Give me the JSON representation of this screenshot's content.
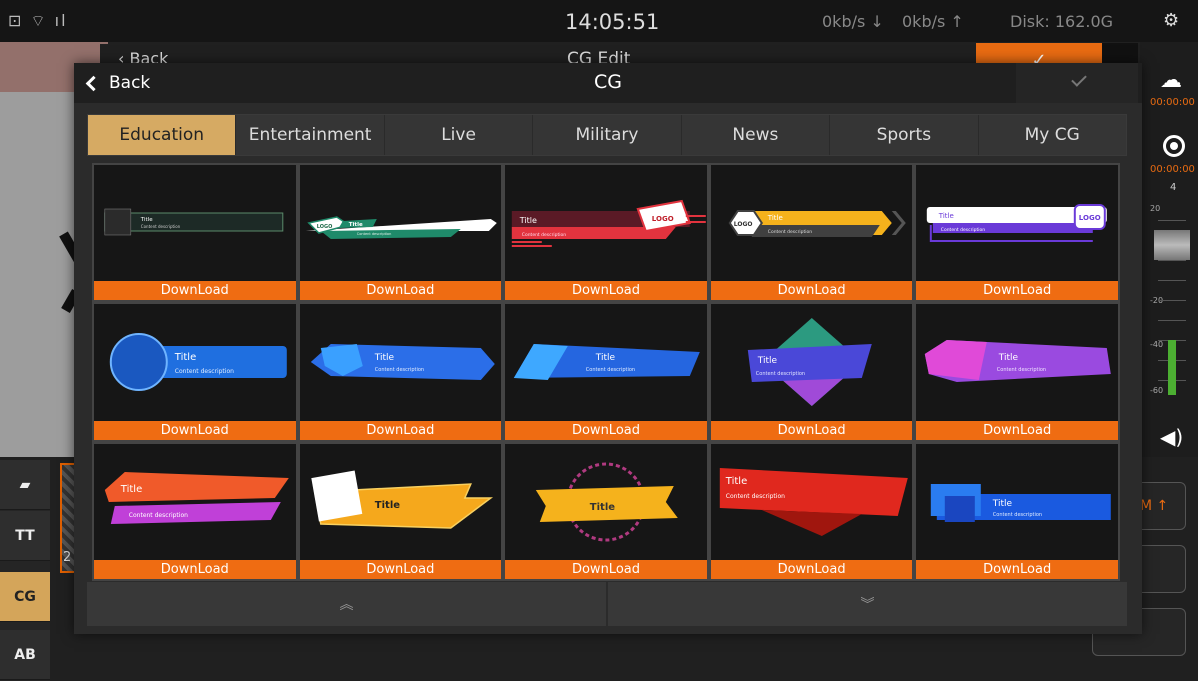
{
  "status": {
    "icons": "⊡ ⌔ ıl",
    "time": "14:05:51",
    "down_rate": "0kb/s ↓",
    "up_rate": "0kb/s ↑",
    "disk": "Disk: 162.0G",
    "settings_icon": "⚙"
  },
  "background": {
    "back_label": "Back",
    "title": "CG Edit",
    "ok_icon": "✓",
    "tools": [
      "▰",
      "TT",
      "CG",
      "AB"
    ],
    "thumb_number": "2",
    "right_time1": "00:00:00",
    "right_time2": "00:00:00",
    "right_count": "4",
    "meter_labels": [
      "20",
      "-20",
      "-40",
      "-60"
    ],
    "rbtn1": "M ↑"
  },
  "dialog": {
    "back_label": "Back",
    "title": "CG",
    "tabs": [
      "Education",
      "Entertainment",
      "Live",
      "Military",
      "News",
      "Sports",
      "My CG"
    ],
    "active_tab": "Education",
    "download_label": "DownLoad",
    "items": [
      {
        "title": "Title",
        "desc": "Content description",
        "style": "minimal-dark"
      },
      {
        "title": "Title",
        "desc": "Content description",
        "logo": "LOGO",
        "style": "white-green"
      },
      {
        "title": "Title",
        "desc": "Content description",
        "logo": "LOGO",
        "style": "red-stripes"
      },
      {
        "title": "Title",
        "desc": "Content description",
        "logo": "LOGO",
        "style": "yellow-hex"
      },
      {
        "title": "Title",
        "desc": "Content description",
        "logo": "LOGO",
        "style": "white-purple"
      },
      {
        "title": "Title",
        "desc": "Content description",
        "style": "blue-circle"
      },
      {
        "title": "Title",
        "desc": "Content description",
        "style": "blue-pentagon"
      },
      {
        "title": "Title",
        "desc": "Content description",
        "style": "blue-skew"
      },
      {
        "title": "Title",
        "desc": "Content description",
        "style": "diamond-teal"
      },
      {
        "title": "Title",
        "desc": "Content description",
        "style": "pink-purple"
      },
      {
        "title": "Title",
        "desc": "Content description",
        "style": "orange-magenta"
      },
      {
        "title": "Title",
        "desc": "",
        "style": "yellow-arrow"
      },
      {
        "title": "Title",
        "desc": "",
        "style": "yellow-ornament"
      },
      {
        "title": "Title",
        "desc": "Content description",
        "style": "red-fold"
      },
      {
        "title": "Title",
        "desc": "Content description",
        "style": "blue-mosaic"
      }
    ],
    "pager_up": "︽",
    "pager_down": "︾"
  },
  "colors": {
    "accent_orange": "#ef6c12",
    "active_tab": "#d6aa63"
  }
}
